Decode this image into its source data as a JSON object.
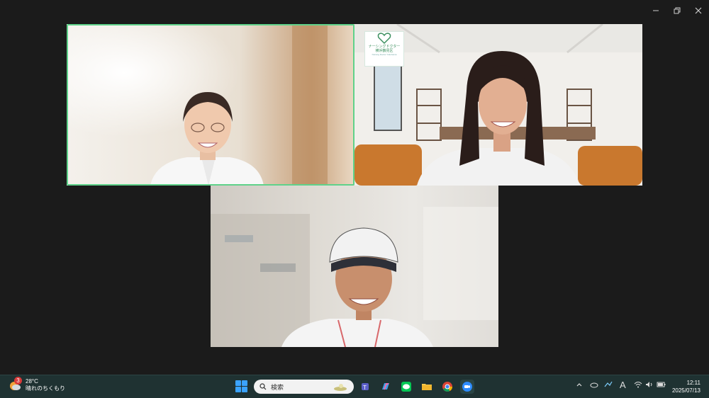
{
  "meeting": {
    "tile2_logo": {
      "line1": "ナーシングドクター",
      "line2": "横浜鶴見区",
      "line3": "Nursing Doctor Yokohama"
    }
  },
  "window_controls": {
    "minimize_icon": "minimize-icon",
    "restore_icon": "restore-icon",
    "close_icon": "close-icon"
  },
  "taskbar": {
    "weather": {
      "badge": "3",
      "temperature": "28°C",
      "condition": "晴れのちくもり"
    },
    "search": {
      "placeholder": "検索"
    },
    "apps": [
      "teams-icon",
      "copilot-icon",
      "line-icon",
      "file-explorer-icon",
      "chrome-icon",
      "zoom-icon"
    ],
    "clock": {
      "time": "12:11",
      "date": "2025/07/13"
    },
    "tray_ime": "A"
  },
  "colors": {
    "active_speaker_border": "#5fd28a",
    "taskbar_bg": "#1f3232",
    "app_bg": "#1b1b1b"
  }
}
